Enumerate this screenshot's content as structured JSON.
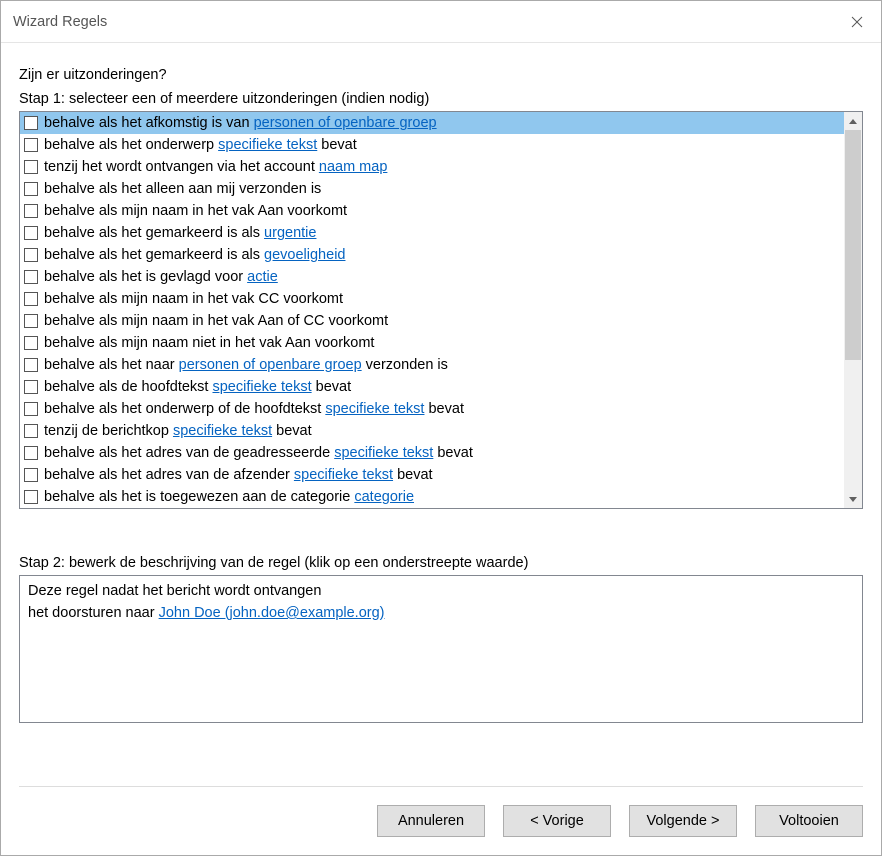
{
  "window": {
    "title": "Wizard Regels"
  },
  "heading": "Zijn er uitzonderingen?",
  "step1_label": "Stap 1: selecteer een of meerdere uitzonderingen (indien nodig)",
  "step2_label": "Stap 2: bewerk de beschrijving van de regel (klik op een onderstreepte waarde)",
  "exceptions": [
    {
      "segments": [
        {
          "t": "behalve als het afkomstig is van "
        },
        {
          "t": "personen of openbare groep",
          "link": true
        }
      ],
      "selected": true
    },
    {
      "segments": [
        {
          "t": "behalve als het onderwerp "
        },
        {
          "t": "specifieke tekst",
          "link": true
        },
        {
          "t": " bevat"
        }
      ]
    },
    {
      "segments": [
        {
          "t": "tenzij het wordt ontvangen via het account "
        },
        {
          "t": "naam map",
          "link": true
        }
      ]
    },
    {
      "segments": [
        {
          "t": "behalve als het alleen aan mij verzonden is"
        }
      ]
    },
    {
      "segments": [
        {
          "t": "behalve als mijn naam in het vak Aan voorkomt"
        }
      ]
    },
    {
      "segments": [
        {
          "t": "behalve als het gemarkeerd is als "
        },
        {
          "t": "urgentie",
          "link": true
        }
      ]
    },
    {
      "segments": [
        {
          "t": "behalve als het gemarkeerd is als "
        },
        {
          "t": "gevoeligheid",
          "link": true
        }
      ]
    },
    {
      "segments": [
        {
          "t": "behalve als het is gevlagd voor "
        },
        {
          "t": "actie",
          "link": true
        }
      ]
    },
    {
      "segments": [
        {
          "t": "behalve als mijn naam in het vak CC voorkomt"
        }
      ]
    },
    {
      "segments": [
        {
          "t": "behalve als mijn naam in het vak Aan of CC voorkomt"
        }
      ]
    },
    {
      "segments": [
        {
          "t": "behalve als mijn naam niet in het vak Aan voorkomt"
        }
      ]
    },
    {
      "segments": [
        {
          "t": "behalve als het naar "
        },
        {
          "t": "personen of openbare groep",
          "link": true
        },
        {
          "t": " verzonden is"
        }
      ]
    },
    {
      "segments": [
        {
          "t": "behalve als de hoofdtekst "
        },
        {
          "t": "specifieke tekst",
          "link": true
        },
        {
          "t": " bevat"
        }
      ]
    },
    {
      "segments": [
        {
          "t": "behalve als het onderwerp of de hoofdtekst "
        },
        {
          "t": "specifieke tekst",
          "link": true
        },
        {
          "t": " bevat"
        }
      ]
    },
    {
      "segments": [
        {
          "t": "tenzij de berichtkop "
        },
        {
          "t": "specifieke tekst",
          "link": true
        },
        {
          "t": " bevat"
        }
      ]
    },
    {
      "segments": [
        {
          "t": "behalve als het adres van de geadresseerde "
        },
        {
          "t": "specifieke tekst",
          "link": true
        },
        {
          "t": " bevat"
        }
      ]
    },
    {
      "segments": [
        {
          "t": "behalve als het adres van de afzender "
        },
        {
          "t": "specifieke tekst",
          "link": true
        },
        {
          "t": " bevat"
        }
      ]
    },
    {
      "segments": [
        {
          "t": "behalve als het is toegewezen aan de categorie "
        },
        {
          "t": "categorie",
          "link": true
        }
      ]
    }
  ],
  "description": {
    "line1": {
      "segments": [
        {
          "t": "Deze regel nadat het bericht wordt ontvangen"
        }
      ]
    },
    "line2": {
      "segments": [
        {
          "t": "het doorsturen naar "
        },
        {
          "t": "John Doe (john.doe@example.org)",
          "link": true
        }
      ]
    }
  },
  "buttons": {
    "cancel": "Annuleren",
    "back": "< Vorige",
    "next": "Volgende >",
    "finish": "Voltooien"
  }
}
